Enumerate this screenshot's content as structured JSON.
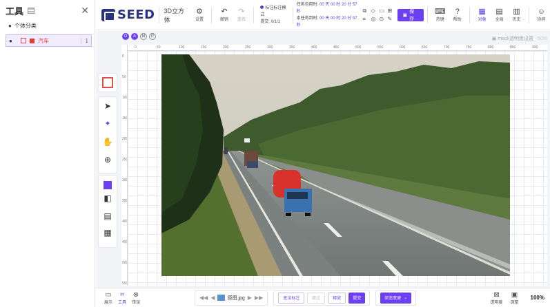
{
  "left_panel": {
    "title": "工具",
    "close": "✕",
    "group_label": "个体分类",
    "items": [
      {
        "label": "汽车",
        "count": "1",
        "color": "#e53935"
      }
    ]
  },
  "topbar": {
    "logo": "SEED",
    "mode": "3D立方体",
    "buttons": {
      "settings": "设置",
      "undo": "撤销",
      "redo": "重做",
      "hotkey": "热键",
      "help": "帮助",
      "object": "对象",
      "global": "全局",
      "history": "历史",
      "collab": "协同"
    },
    "annotation_mode": "标注标注模式",
    "submit_progress": "提交: 0/1/1",
    "task_time_label": "任务包用时:",
    "task_time_value": "00 天 00 时 20 分 57 秒",
    "item_time_label": "本任务用时:",
    "item_time_value": "00 天 00 时 20 分 57 秒",
    "save": "保存"
  },
  "workspace": {
    "annotation_tags": [
      "O",
      "A",
      "M",
      "P"
    ],
    "mask_label": "mask透明度设置",
    "mask_value": "50%",
    "ruler_h": [
      "0",
      "50",
      "100",
      "150",
      "200",
      "250",
      "300",
      "350",
      "400",
      "450",
      "500",
      "550",
      "600",
      "650",
      "700",
      "750",
      "800",
      "850",
      "900"
    ],
    "ruler_v": [
      "0",
      "50",
      "100",
      "150",
      "200",
      "250",
      "300",
      "350",
      "400",
      "450",
      "500",
      "550"
    ]
  },
  "bottombar": {
    "buttons": {
      "display": "展示",
      "tool": "工具",
      "error": "错误"
    },
    "image_name": "原图.jpg",
    "no_annotate": "无法标注",
    "skip": "跳过",
    "release": "释放",
    "submit": "提交",
    "status_change": "状态变更",
    "transparency": "透明度",
    "adjust": "调整",
    "zoom": "100%"
  },
  "colors": {
    "accent": "#6c3ff3",
    "logo": "#2b3280",
    "class_red": "#e53935"
  }
}
